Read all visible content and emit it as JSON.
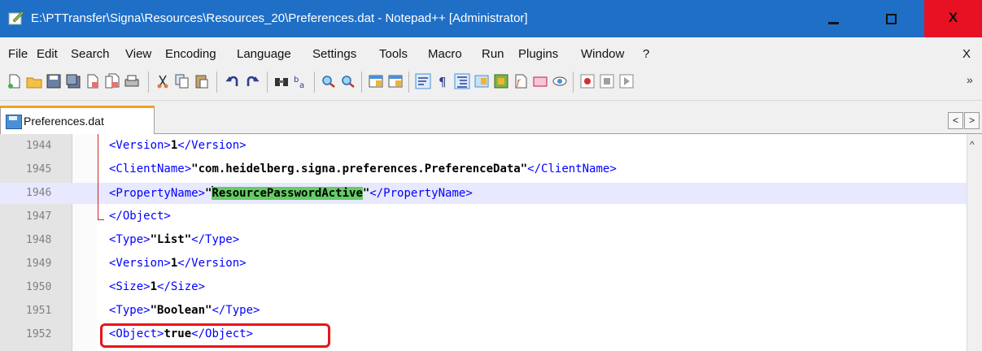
{
  "window": {
    "title": "E:\\PTTransfer\\Signa\\Resources\\Resources_20\\Preferences.dat - Notepad++ [Administrator]",
    "minimize_label": "",
    "maximize_label": "",
    "close_label": "X"
  },
  "menu": {
    "items": [
      "File",
      "Edit",
      "Search",
      "View",
      "Encoding",
      "Language",
      "Settings",
      "Tools",
      "Macro",
      "Run",
      "Plugins",
      "Window",
      "?"
    ],
    "close_doc": "X"
  },
  "toolbar": {
    "overflow": "»",
    "icons": [
      "new-file-icon",
      "open-file-icon",
      "save-icon",
      "save-all-icon",
      "close-icon",
      "close-all-icon",
      "print-icon",
      "cut-icon",
      "copy-icon",
      "paste-icon",
      "undo-icon",
      "redo-icon",
      "find-icon",
      "replace-icon",
      "zoom-in-icon",
      "zoom-out-icon",
      "sync-vertical-icon",
      "sync-horizontal-icon",
      "word-wrap-icon",
      "show-all-chars-icon",
      "indent-guide-icon",
      "doc-map-icon",
      "function-list-icon",
      "folder-workspace-icon",
      "doc-list-icon",
      "monitor-icon",
      "record-macro-icon",
      "stop-macro-icon",
      "play-macro-icon"
    ]
  },
  "tabs": [
    {
      "label": "Preferences.dat",
      "active": true
    }
  ],
  "tab_scroll": {
    "left": "<",
    "right": ">"
  },
  "editor": {
    "lines": [
      {
        "num": "1944",
        "open": "<Version>",
        "value": "1",
        "close": "</Version>"
      },
      {
        "num": "1945",
        "open": "<ClientName>",
        "value": "\"com.heidelberg.signa.preferences.PreferenceData\"",
        "close": "</ClientName>"
      },
      {
        "num": "1946",
        "open": "<PropertyName>",
        "value_pre": "\"",
        "value_hl": "ResourcePasswordActive",
        "value_post": "\"",
        "close": "</PropertyName>",
        "current": true
      },
      {
        "num": "1947",
        "open": "</Object>",
        "value": "",
        "close": ""
      },
      {
        "num": "1948",
        "open": "<Type>",
        "value": "\"List\"",
        "close": "</Type>"
      },
      {
        "num": "1949",
        "open": "<Version>",
        "value": "1",
        "close": "</Version>"
      },
      {
        "num": "1950",
        "open": "<Size>",
        "value": "1",
        "close": "</Size>"
      },
      {
        "num": "1951",
        "open": "<Type>",
        "value": "\"Boolean\"",
        "close": "</Type>"
      },
      {
        "num": "1952",
        "open": "<Object>",
        "value": "true",
        "close": "</Object>"
      }
    ]
  },
  "colors": {
    "titlebar": "#1f6fc7",
    "close_button": "#e81123",
    "tab_accent": "#f3a21b",
    "tag": "#0000ff",
    "highlight": "#66cc66",
    "callout": "#e8141a"
  }
}
